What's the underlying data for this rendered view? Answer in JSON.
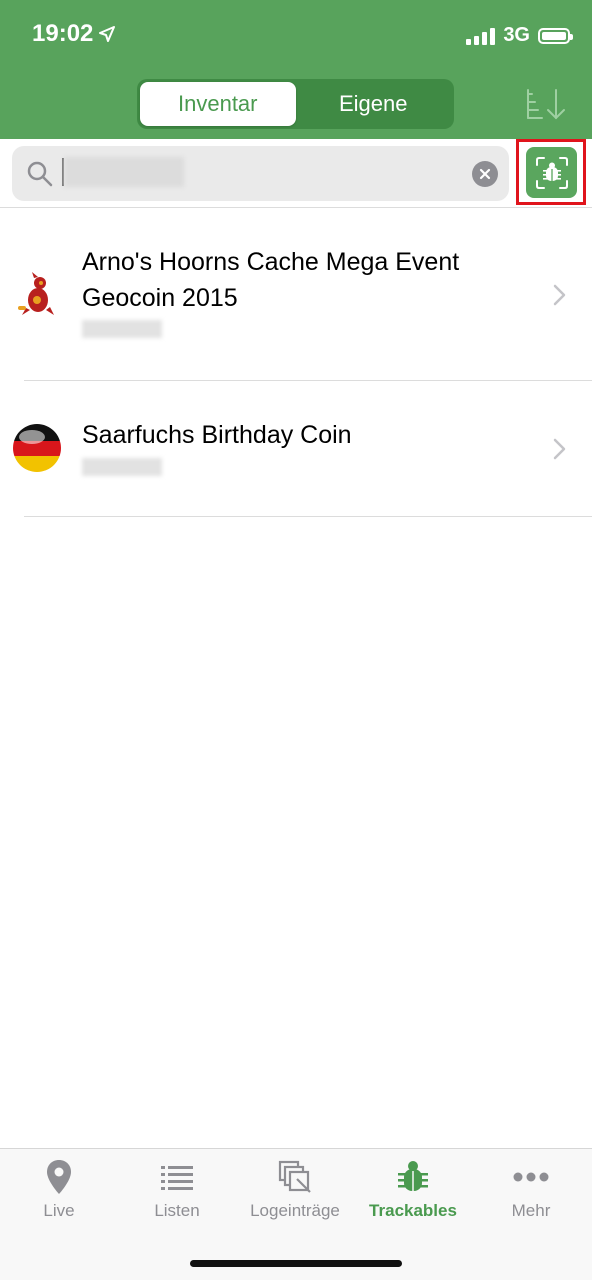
{
  "status_bar": {
    "time": "19:02",
    "network": "3G"
  },
  "segment": {
    "tabs": [
      {
        "label": "Inventar",
        "active": true
      },
      {
        "label": "Eigene",
        "active": false
      }
    ]
  },
  "search": {
    "placeholder": "",
    "value": ""
  },
  "list": {
    "items": [
      {
        "title_line1": "Arno's Hoorns Cache Mega Event",
        "title_line2": "Geocoin 2015"
      },
      {
        "title_line1": "Saarfuchs Birthday Coin"
      }
    ]
  },
  "tabbar": {
    "tabs": [
      {
        "label": "Live",
        "icon": "map-pin-icon"
      },
      {
        "label": "Listen",
        "icon": "list-icon"
      },
      {
        "label": "Logeinträge",
        "icon": "logs-icon"
      },
      {
        "label": "Trackables",
        "icon": "bug-icon",
        "active": true
      },
      {
        "label": "Mehr",
        "icon": "more-icon"
      }
    ]
  },
  "colors": {
    "brand": "#58a35c",
    "highlight": "#e0141c",
    "inactive": "#8e8e93"
  }
}
